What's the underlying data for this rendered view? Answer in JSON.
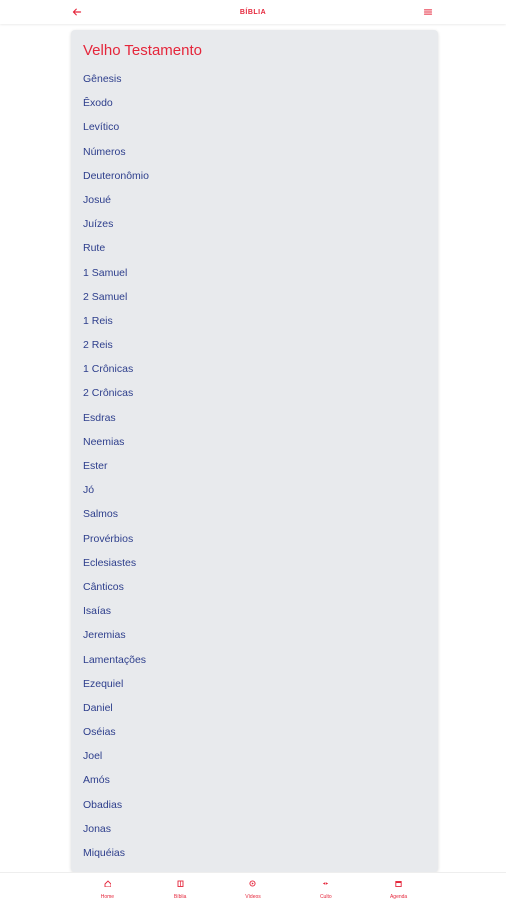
{
  "header": {
    "title": "BÍBLIA",
    "back_icon": "arrow-left-icon",
    "menu_icon": "hamburger-menu-icon"
  },
  "section": {
    "title": "Velho Testamento",
    "books": [
      "Gênesis",
      "Êxodo",
      "Levítico",
      "Números",
      "Deuteronômio",
      "Josué",
      "Juízes",
      "Rute",
      "1 Samuel",
      "2 Samuel",
      "1 Reis",
      "2 Reis",
      "1 Crônicas",
      "2 Crônicas",
      "Esdras",
      "Neemias",
      "Ester",
      "Jó",
      "Salmos",
      "Provérbios",
      "Eclesiastes",
      "Cânticos",
      "Isaías",
      "Jeremias",
      "Lamentações",
      "Ezequiel",
      "Daniel",
      "Oséias",
      "Joel",
      "Amós",
      "Obadias",
      "Jonas",
      "Miquéias"
    ]
  },
  "nav": {
    "items": [
      {
        "label": "Home",
        "icon": "home-icon"
      },
      {
        "label": "Bíblia",
        "icon": "book-icon"
      },
      {
        "label": "Vídeos",
        "icon": "video-icon"
      },
      {
        "label": "Culto",
        "icon": "worship-icon"
      },
      {
        "label": "Agenda",
        "icon": "calendar-icon"
      }
    ]
  },
  "colors": {
    "accent": "#e5263b",
    "book_text": "#2d3e8c",
    "card_bg": "#e8eaed"
  }
}
